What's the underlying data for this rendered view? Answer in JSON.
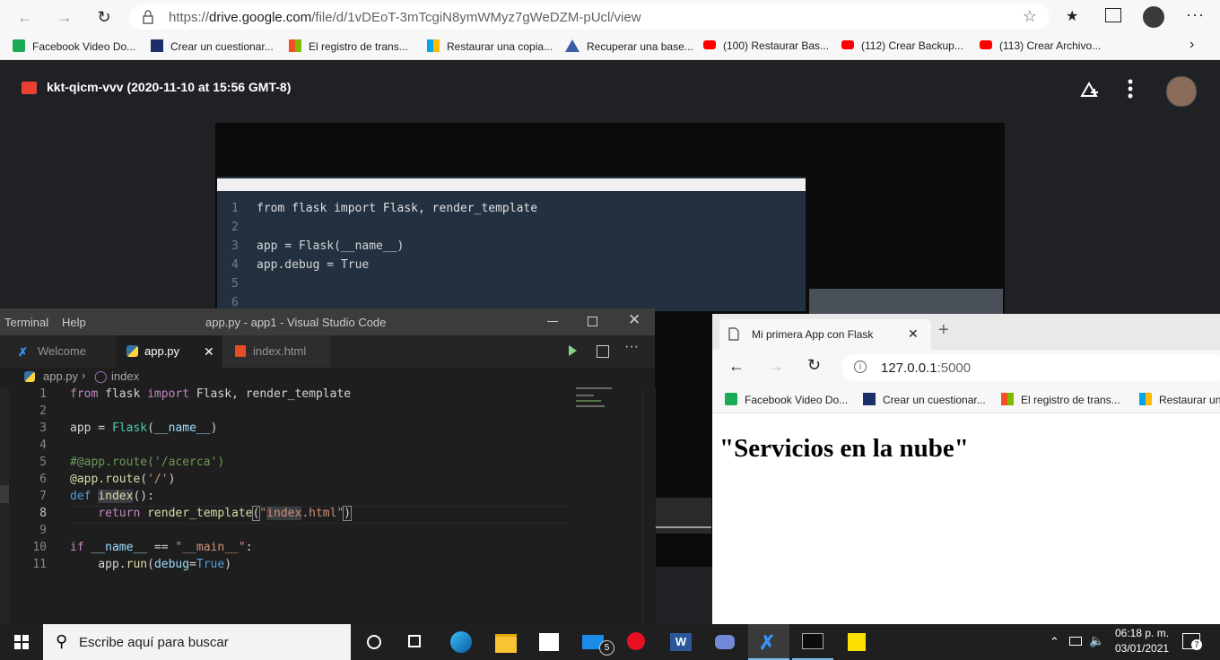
{
  "edge": {
    "url_prefix": "https://",
    "url_domain": "drive.google.com",
    "url_path": "/file/d/1vDEoT-3mTcgiN8ymWMyz7gWeDZM-pUcl/view",
    "bookmarks": [
      "Facebook Video Do...",
      "Crear un cuestionar...",
      "El registro de trans...",
      "Restaurar una copia...",
      "Recuperar una base...",
      "(100) Restaurar Bas...",
      "(112) Crear Backup...",
      "(113) Crear Archivo..."
    ]
  },
  "drive": {
    "file_title": "kkt-qicm-vvv (2020-11-10 at 15:56 GMT-8)"
  },
  "video": {
    "lines": [
      {
        "n": "1",
        "text": "from flask import Flask, render_template"
      },
      {
        "n": "2",
        "text": ""
      },
      {
        "n": "3",
        "text": "app = Flask(__name__)"
      },
      {
        "n": "4",
        "text": "app.debug = True"
      },
      {
        "n": "5",
        "text": ""
      },
      {
        "n": "6",
        "text": ""
      }
    ]
  },
  "vscode": {
    "menu": [
      "Terminal",
      "Help"
    ],
    "title": "app.py - app1 - Visual Studio Code",
    "tabs": [
      "Welcome",
      "app.py",
      "index.html"
    ],
    "breadcrumb": [
      "app.py",
      "index"
    ],
    "line_numbers": [
      "1",
      "2",
      "3",
      "4",
      "5",
      "6",
      "7",
      "8",
      "9",
      "10",
      "11"
    ]
  },
  "browser": {
    "tab_title": "Mi primera App con Flask",
    "url_host": "127.0.0.1",
    "url_port": ":5000",
    "bookmarks": [
      "Facebook Video Do...",
      "Crear un cuestionar...",
      "El registro de trans...",
      "Restaurar un"
    ],
    "heading": "\"Servicios en la nube\""
  },
  "taskbar": {
    "search_placeholder": "Escribe aquí para buscar",
    "mail_badge": "5",
    "time": "06:18 p. m.",
    "date": "03/01/2021",
    "notif_count": "7"
  }
}
